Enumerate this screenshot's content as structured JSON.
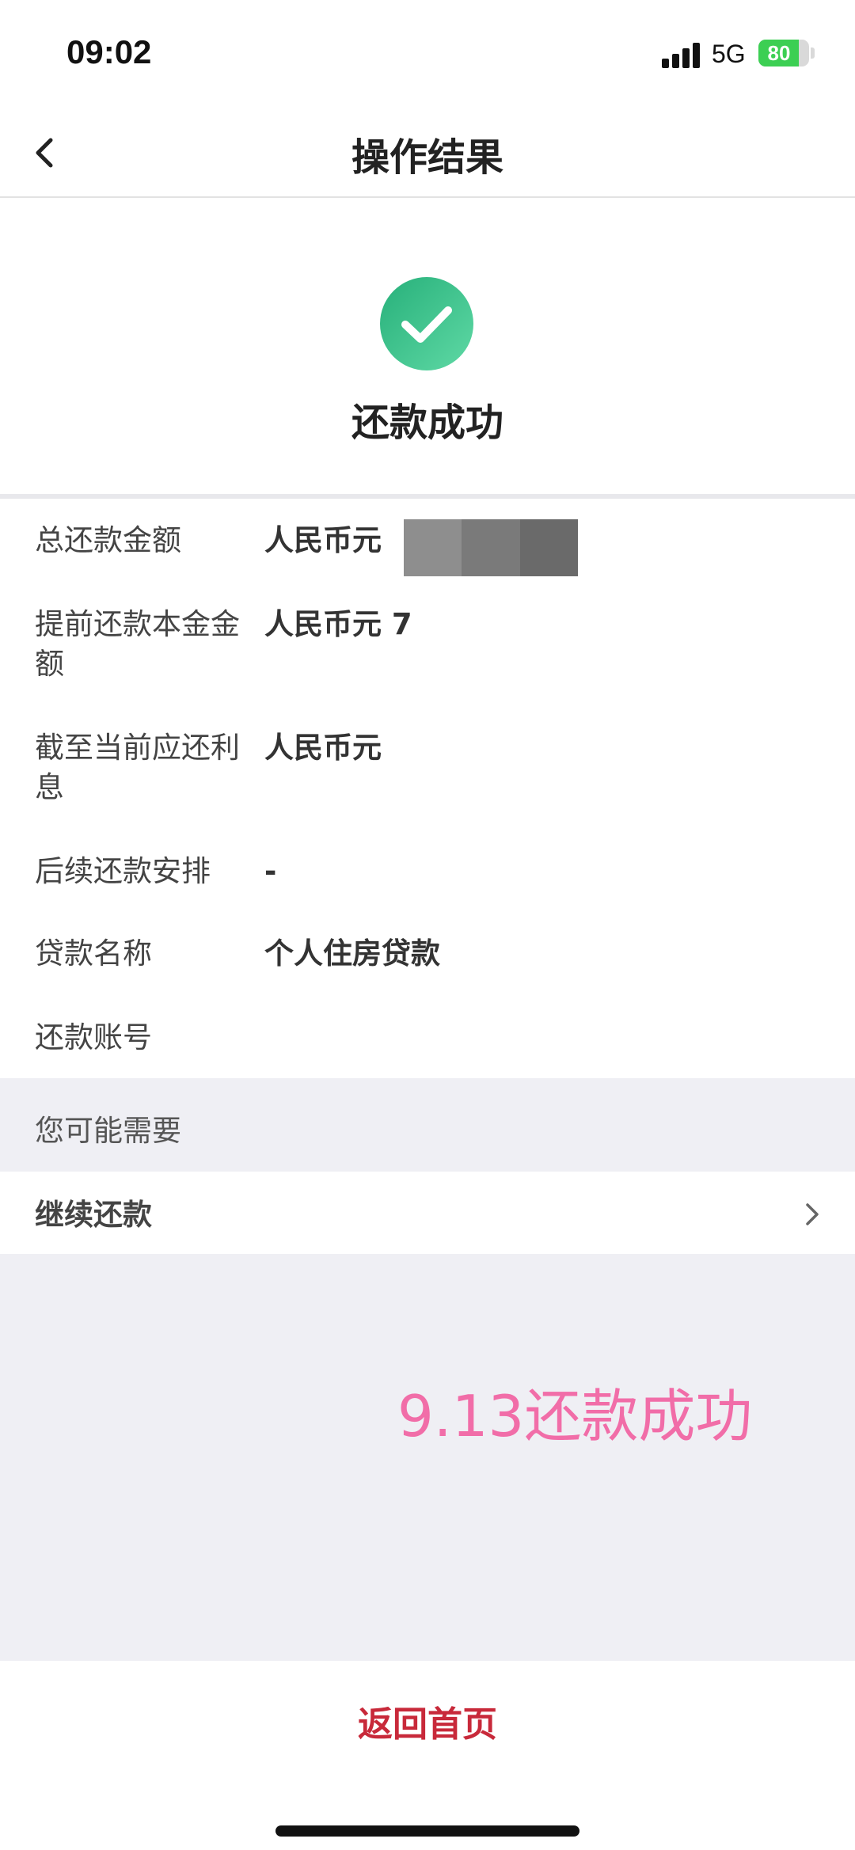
{
  "status_bar": {
    "time": "09:02",
    "network": "5G",
    "battery_percent": 80,
    "battery_label": "80",
    "battery_color": "#3ccf53"
  },
  "nav": {
    "title": "操作结果",
    "back_icon": "chevron-left-icon"
  },
  "result": {
    "icon": "check-circle-icon",
    "icon_color": "#2ebd87",
    "title": "还款成功"
  },
  "details": [
    {
      "label": "总还款金额",
      "value": "人民币元 "
    },
    {
      "label": "提前还款本金金额",
      "value": "人民币元 7"
    },
    {
      "label": "截至当前应还利息",
      "value": "人民币元"
    },
    {
      "label": "后续还款安排",
      "value": "-"
    },
    {
      "label": "贷款名称",
      "value": "个人住房贷款"
    },
    {
      "label": "还款账号",
      "value": ""
    }
  ],
  "suggestions": {
    "section_title": "您可能需要",
    "continue_label": "继续还款",
    "continue_icon": "chevron-right-icon"
  },
  "annotation": {
    "text": "9.13还款成功",
    "color": "#f16da8"
  },
  "bottom": {
    "home_label": "返回首页",
    "accent": "#c8293a"
  }
}
